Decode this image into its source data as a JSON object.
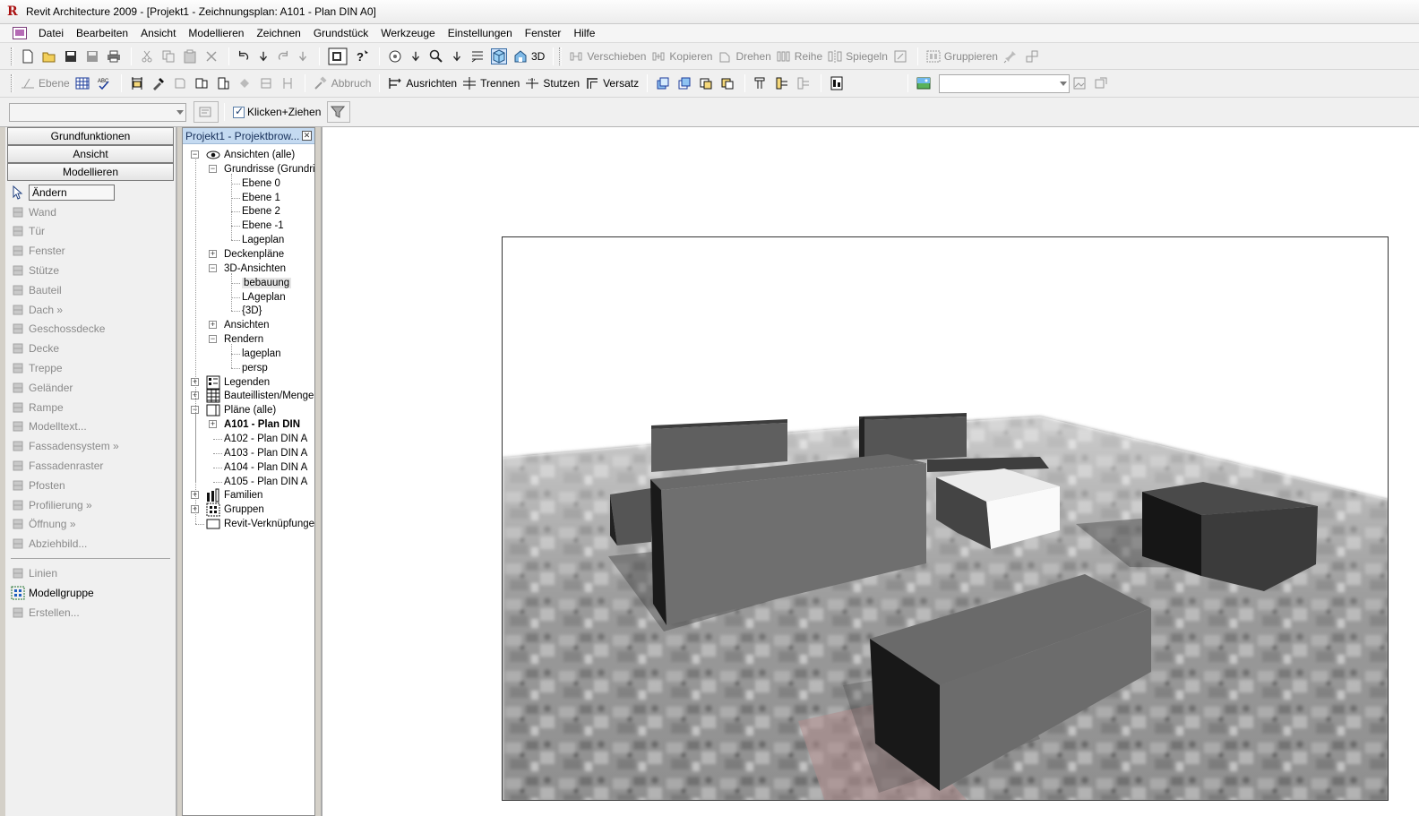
{
  "window": {
    "title": "Revit Architecture 2009 - [Projekt1 - Zeichnungsplan: A101 - Plan DIN A0]"
  },
  "menu": [
    "Datei",
    "Bearbeiten",
    "Ansicht",
    "Modellieren",
    "Zeichnen",
    "Grundstück",
    "Werkzeuge",
    "Einstellungen",
    "Fenster",
    "Hilfe"
  ],
  "toolbar1": {
    "view3d_label": "3D",
    "edit_buttons": [
      "Verschieben",
      "Kopieren",
      "Drehen",
      "Reihe",
      "Spiegeln"
    ],
    "group_label": "Gruppieren"
  },
  "toolbar2": {
    "level_label": "Ebene",
    "cut_label": "Abbruch",
    "align_label": "Ausrichten",
    "split_label": "Trennen",
    "trim_label": "Stutzen",
    "offset_label": "Versatz"
  },
  "toolbar3": {
    "drag_label": "Klicken+Ziehen",
    "drag_checked": true
  },
  "designbar": {
    "tabs": [
      "Grundfunktionen",
      "Ansicht",
      "Modellieren"
    ],
    "tools": [
      {
        "label": "Ändern",
        "icon": "cursor-icon",
        "state": "selected"
      },
      {
        "label": "Wand",
        "icon": "wall-icon",
        "state": "disabled"
      },
      {
        "label": "Tür",
        "icon": "door-icon",
        "state": "disabled"
      },
      {
        "label": "Fenster",
        "icon": "window-icon",
        "state": "disabled"
      },
      {
        "label": "Stütze",
        "icon": "column-icon",
        "state": "disabled"
      },
      {
        "label": "Bauteil",
        "icon": "component-icon",
        "state": "disabled"
      },
      {
        "label": "Dach »",
        "icon": "roof-icon",
        "state": "disabled"
      },
      {
        "label": "Geschossdecke",
        "icon": "floor-icon",
        "state": "disabled"
      },
      {
        "label": "Decke",
        "icon": "ceiling-icon",
        "state": "disabled"
      },
      {
        "label": "Treppe",
        "icon": "stair-icon",
        "state": "disabled"
      },
      {
        "label": "Geländer",
        "icon": "railing-icon",
        "state": "disabled"
      },
      {
        "label": "Rampe",
        "icon": "ramp-icon",
        "state": "disabled"
      },
      {
        "label": "Modelltext...",
        "icon": "model-text-icon",
        "state": "disabled"
      },
      {
        "label": "Fassadensystem »",
        "icon": "curtain-system-icon",
        "state": "disabled"
      },
      {
        "label": "Fassadenraster",
        "icon": "curtain-grid-icon",
        "state": "disabled"
      },
      {
        "label": "Pfosten",
        "icon": "mullion-icon",
        "state": "disabled"
      },
      {
        "label": "Profilierung »",
        "icon": "sweep-icon",
        "state": "disabled"
      },
      {
        "label": "Öffnung »",
        "icon": "opening-icon",
        "state": "disabled"
      },
      {
        "label": "Abziehbild...",
        "icon": "decal-icon",
        "state": "disabled"
      }
    ],
    "tools2": [
      {
        "label": "Linien",
        "icon": "lines-icon",
        "state": "disabled"
      },
      {
        "label": "Modellgruppe",
        "icon": "model-group-icon",
        "state": "enabled"
      },
      {
        "label": "Erstellen...",
        "icon": "create-icon",
        "state": "disabled"
      }
    ]
  },
  "browser": {
    "title": "Projekt1 - Projektbrow...",
    "nodes": [
      {
        "label": "Ansichten (alle)",
        "level": 0,
        "exp": "-",
        "icon": "eye-icon"
      },
      {
        "label": "Grundrisse (Grundris",
        "level": 1,
        "exp": "-"
      },
      {
        "label": "Ebene 0",
        "level": 2
      },
      {
        "label": "Ebene 1",
        "level": 2
      },
      {
        "label": "Ebene 2",
        "level": 2
      },
      {
        "label": "Ebene -1",
        "level": 2
      },
      {
        "label": "Lageplan",
        "level": 2
      },
      {
        "label": "Deckenpläne",
        "level": 1,
        "exp": "+"
      },
      {
        "label": "3D-Ansichten",
        "level": 1,
        "exp": "-"
      },
      {
        "label": "bebauung",
        "level": 2,
        "hl": true
      },
      {
        "label": "LAgeplan",
        "level": 2
      },
      {
        "label": "{3D}",
        "level": 2
      },
      {
        "label": "Ansichten",
        "level": 1,
        "exp": "+"
      },
      {
        "label": "Rendern",
        "level": 1,
        "exp": "-"
      },
      {
        "label": "lageplan",
        "level": 2
      },
      {
        "label": "persp",
        "level": 2
      },
      {
        "label": "Legenden",
        "level": 0,
        "exp": "+",
        "icon": "legend-icon"
      },
      {
        "label": "Bauteillisten/Menger",
        "level": 0,
        "exp": "+",
        "icon": "schedule-icon"
      },
      {
        "label": "Pläne (alle)",
        "level": 0,
        "exp": "-",
        "icon": "sheet-icon"
      },
      {
        "label": "A101 - Plan DIN",
        "level": 1,
        "exp": "+",
        "bold": true
      },
      {
        "label": "A102 - Plan DIN A",
        "level": 1
      },
      {
        "label": "A103 - Plan DIN A",
        "level": 1
      },
      {
        "label": "A104 - Plan DIN A",
        "level": 1
      },
      {
        "label": "A105 - Plan DIN A",
        "level": 1
      },
      {
        "label": "Familien",
        "level": 0,
        "exp": "+",
        "icon": "family-icon"
      },
      {
        "label": "Gruppen",
        "level": 0,
        "exp": "+",
        "icon": "group-icon"
      },
      {
        "label": "Revit-Verknüpfunger",
        "level": 0,
        "icon": "link-icon"
      }
    ]
  },
  "colors": {
    "accent": "#c4daf1",
    "building_dark": "#5a5a5a",
    "building_light": "#ffffff",
    "ground": "#9a9a9a"
  }
}
